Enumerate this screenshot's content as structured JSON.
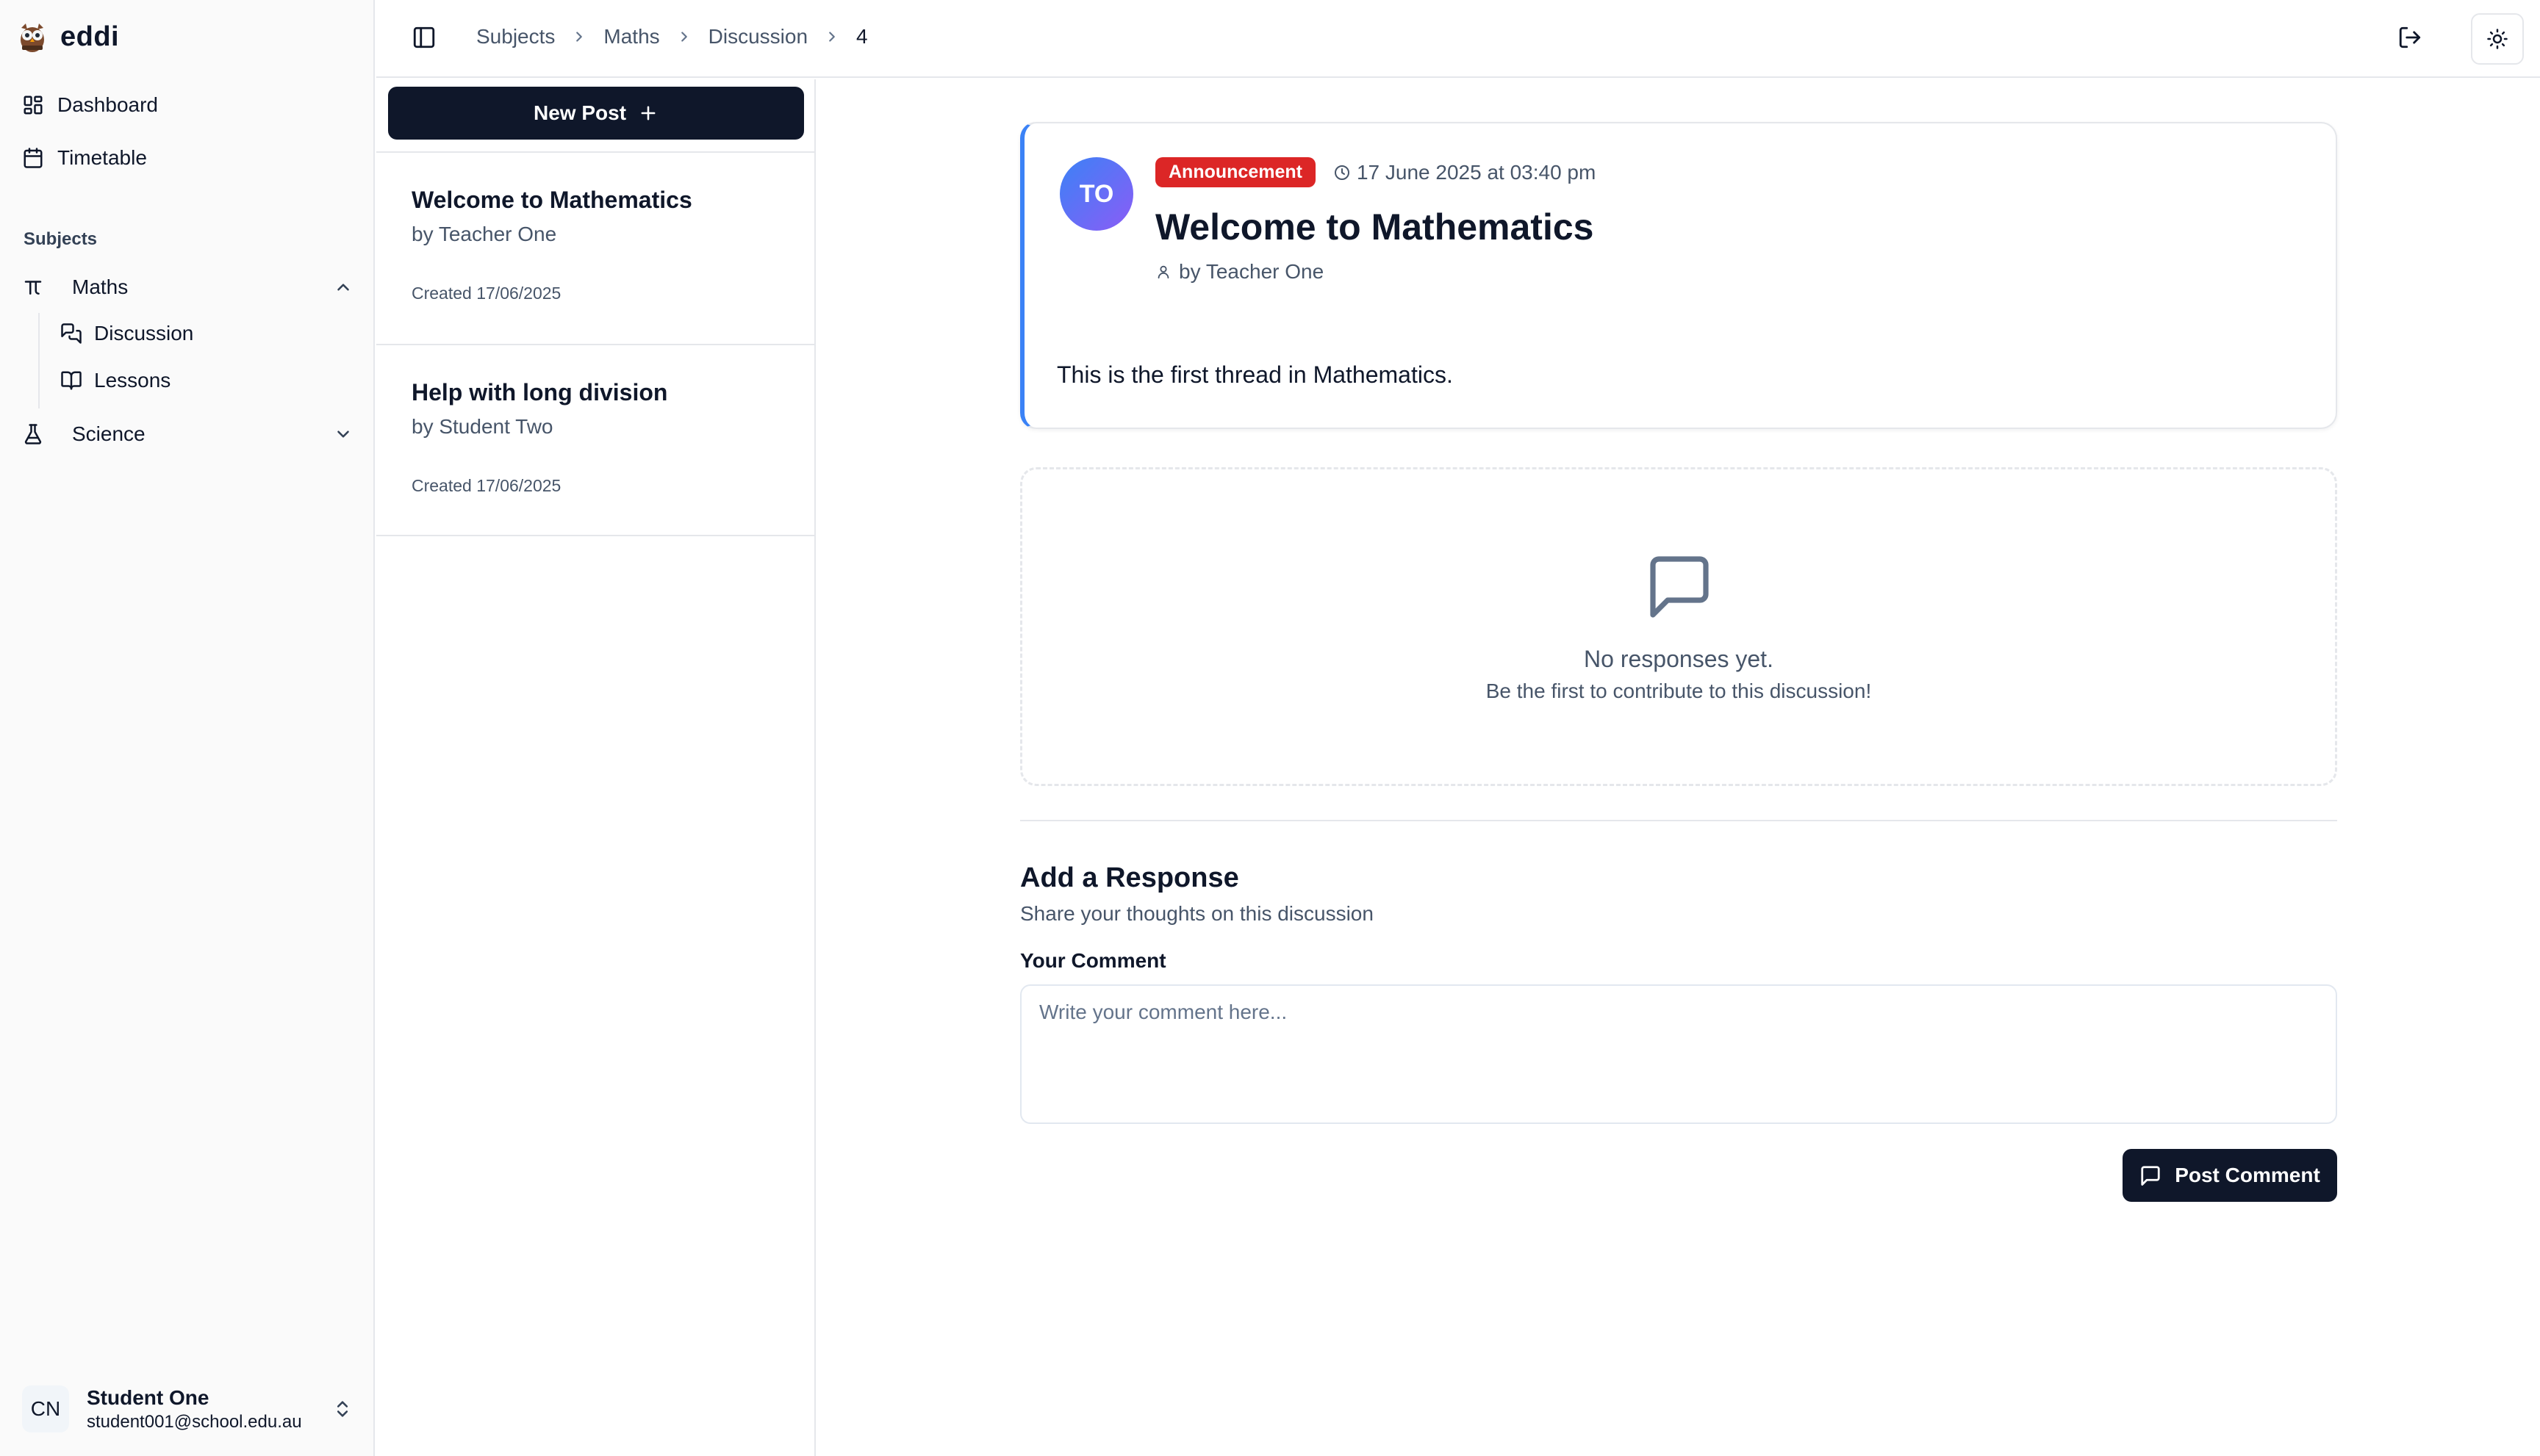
{
  "app": {
    "name": "eddi"
  },
  "sidebar": {
    "nav": [
      {
        "label": "Dashboard",
        "icon": "dashboard-icon"
      },
      {
        "label": "Timetable",
        "icon": "calendar-icon"
      }
    ],
    "section_label": "Subjects",
    "subjects": [
      {
        "label": "Maths",
        "icon": "pi-icon",
        "expanded": true,
        "children": [
          {
            "label": "Discussion",
            "icon": "messages-icon"
          },
          {
            "label": "Lessons",
            "icon": "book-icon"
          }
        ]
      },
      {
        "label": "Science",
        "icon": "flask-icon",
        "expanded": false
      }
    ],
    "user": {
      "initials": "CN",
      "name": "Student One",
      "email": "student001@school.edu.au"
    }
  },
  "header": {
    "breadcrumbs": [
      "Subjects",
      "Maths",
      "Discussion",
      "4"
    ]
  },
  "postlist": {
    "new_post_label": "New Post",
    "posts": [
      {
        "title": "Welcome to Mathematics",
        "author": "by Teacher One",
        "created": "Created 17/06/2025"
      },
      {
        "title": "Help with long division",
        "author": "by Student Two",
        "created": "Created 17/06/2025"
      }
    ]
  },
  "thread": {
    "avatar_initials": "TO",
    "badge": "Announcement",
    "timestamp": "17 June 2025 at 03:40 pm",
    "title": "Welcome to Mathematics",
    "author": "by Teacher One",
    "body": "This is the first thread in Mathematics.",
    "accent_color": "#3b82f6",
    "badge_color": "#dc2626"
  },
  "responses": {
    "empty_title": "No responses yet.",
    "empty_subtitle": "Be the first to contribute to this discussion!"
  },
  "reply_form": {
    "title": "Add a Response",
    "subtitle": "Share your thoughts on this discussion",
    "field_label": "Your Comment",
    "placeholder": "Write your comment here...",
    "value": "",
    "submit_label": "Post Comment"
  }
}
